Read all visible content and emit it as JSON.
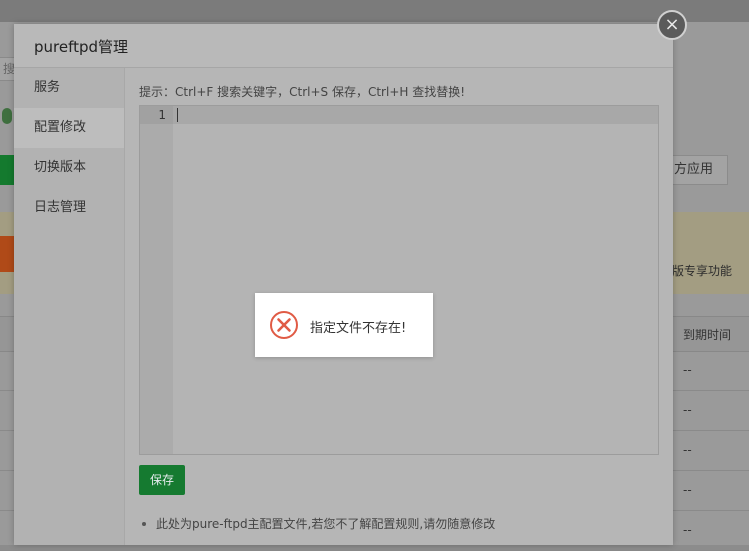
{
  "background": {
    "search_placeholder": "搜索",
    "third_party_button": "方应用",
    "promo_text": "版专享功能",
    "table_header_expiry": "到期时间",
    "table_rows": [
      "--",
      "--",
      "--",
      "--",
      "--"
    ]
  },
  "modal": {
    "title": "pureftpd管理",
    "close_symbol": "×",
    "sidebar": [
      {
        "label": "服务",
        "active": false
      },
      {
        "label": "配置修改",
        "active": true
      },
      {
        "label": "切换版本",
        "active": false
      },
      {
        "label": "日志管理",
        "active": false
      }
    ],
    "tip": "提示：Ctrl+F 搜索关键字，Ctrl+S 保存，Ctrl+H 查找替换!",
    "editor": {
      "line_numbers": [
        "1"
      ],
      "content": ""
    },
    "save_label": "保存",
    "note": "此处为pure-ftpd主配置文件,若您不了解配置规则,请勿随意修改"
  },
  "message": {
    "icon": "error-circle-icon",
    "text": "指定文件不存在!",
    "color": "#e05b45"
  }
}
